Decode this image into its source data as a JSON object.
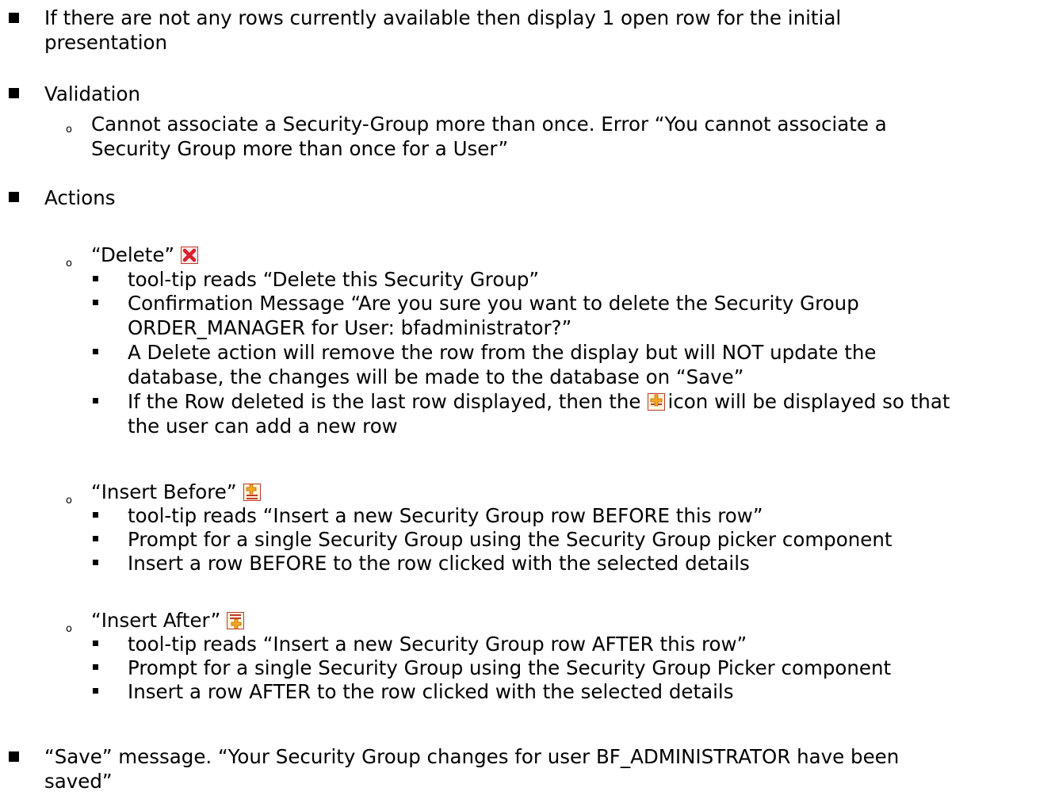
{
  "doc": {
    "item1_line1": "If there are not any rows currently available then display 1 open row for the initial",
    "item1_line2": "presentation",
    "item2_title": "Validation",
    "item2_sub1_line1": "Cannot associate a Security-Group more than once. Error “You cannot associate a",
    "item2_sub1_line2": "Security Group more than once for a User”",
    "item3_title": "Actions",
    "delete": {
      "title": "“Delete”",
      "icon": "delete-red-x-icon",
      "b1": "tool-tip reads “Delete this Security Group”",
      "b2_line1": "Confirmation Message “Are you sure you want to delete the Security Group",
      "b2_line2": "ORDER_MANAGER for User: bfadministrator?”",
      "b3_line1": "A Delete action will remove the row from the display but will NOT update the",
      "b3_line2": "database, the changes will be made to the database on “Save”",
      "b4_line1a": "If the Row deleted is the last row displayed, then the",
      "b4_icon": "insert-row-icon",
      "b4_line1b": "icon will be displayed so that",
      "b4_line2": "the user can add a new row"
    },
    "insert_before": {
      "title": "“Insert Before”",
      "icon": "insert-before-icon",
      "b1": "tool-tip reads “Insert a new Security Group row BEFORE this row”",
      "b2": "Prompt for a single Security Group using the Security Group picker component",
      "b3": "Insert a row BEFORE to the row clicked with the selected details"
    },
    "insert_after": {
      "title": "“Insert After”",
      "icon": "insert-after-icon",
      "b1": "tool-tip reads “Insert a new Security Group row AFTER this row”",
      "b2": "Prompt for a single Security Group using the Security Group Picker component",
      "b3": "Insert a row AFTER to the row clicked with the selected details"
    },
    "item4_line1": "“Save” message. “Your Security Group changes for user BF_ADMINISTRATOR have been",
    "item4_line2": "saved”"
  },
  "colors": {
    "delete_red": "#d8202a",
    "insert_orange": "#f5a623",
    "icon_border": "#c0392b"
  }
}
